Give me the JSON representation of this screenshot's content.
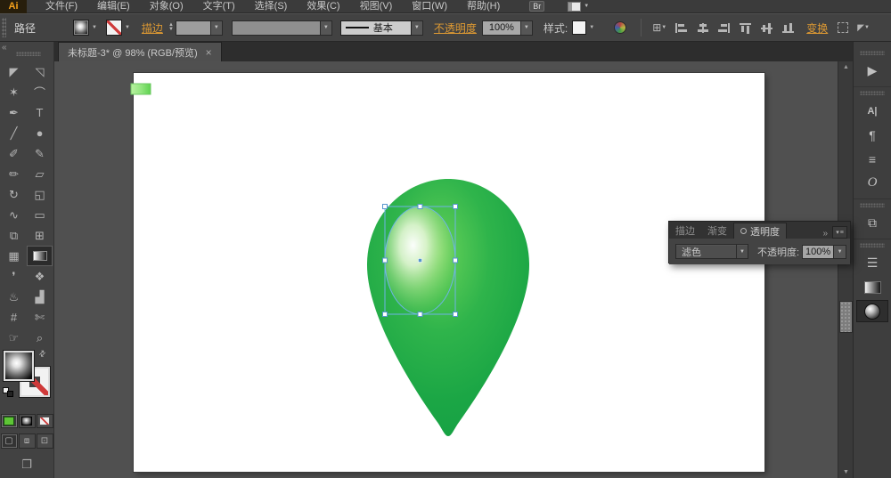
{
  "menubar": {
    "logo": "Ai",
    "items": [
      "文件(F)",
      "编辑(E)",
      "对象(O)",
      "文字(T)",
      "选择(S)",
      "效果(C)",
      "视图(V)",
      "窗口(W)",
      "帮助(H)"
    ],
    "bridge_button": "Br"
  },
  "controlbar": {
    "context_label": "路径",
    "stroke_link": "描边",
    "brush_definition": "基本",
    "opacity_link": "不透明度",
    "opacity_value": "100%",
    "style_label": "样式:",
    "transform_link": "变换"
  },
  "tabbar": {
    "document_title": "未标题-3* @ 98% (RGB/预览)"
  },
  "tools": [
    {
      "name": "selection-tool",
      "active": false
    },
    {
      "name": "direct-selection-tool",
      "active": false
    },
    {
      "name": "magic-wand-tool",
      "active": false
    },
    {
      "name": "lasso-tool",
      "active": false
    },
    {
      "name": "pen-tool",
      "active": false
    },
    {
      "name": "type-tool",
      "active": false
    },
    {
      "name": "line-segment-tool",
      "active": false
    },
    {
      "name": "ellipse-tool",
      "active": false
    },
    {
      "name": "paintbrush-tool",
      "active": false
    },
    {
      "name": "pencil-tool",
      "active": false
    },
    {
      "name": "blob-brush-tool",
      "active": false
    },
    {
      "name": "eraser-tool",
      "active": false
    },
    {
      "name": "rotate-tool",
      "active": false
    },
    {
      "name": "scale-tool",
      "active": false
    },
    {
      "name": "width-tool",
      "active": false
    },
    {
      "name": "free-transform-tool",
      "active": false
    },
    {
      "name": "shape-builder-tool",
      "active": false
    },
    {
      "name": "perspective-grid-tool",
      "active": false
    },
    {
      "name": "mesh-tool",
      "active": false
    },
    {
      "name": "gradient-tool",
      "active": true
    },
    {
      "name": "eyedropper-tool",
      "active": false
    },
    {
      "name": "blend-tool",
      "active": false
    },
    {
      "name": "symbol-sprayer-tool",
      "active": false
    },
    {
      "name": "column-graph-tool",
      "active": false
    },
    {
      "name": "artboard-tool",
      "active": false
    },
    {
      "name": "slice-tool",
      "active": false
    },
    {
      "name": "hand-tool",
      "active": false
    },
    {
      "name": "zoom-tool",
      "active": false
    }
  ],
  "dock_icons": [
    {
      "name": "play-icon",
      "group_start": true
    },
    {
      "name": "character-panel-icon",
      "group_start": true
    },
    {
      "name": "paragraph-panel-icon"
    },
    {
      "name": "paragraph-styles-panel-icon"
    },
    {
      "name": "opentype-panel-icon"
    },
    {
      "name": "appearance-panel-icon",
      "group_start": true
    },
    {
      "name": "stroke-panel-icon",
      "group_start": true
    },
    {
      "name": "gradient-panel-icon"
    },
    {
      "name": "transparency-panel-icon",
      "active": true
    }
  ],
  "transparency_panel": {
    "tabs": [
      "描边",
      "渐变",
      "透明度"
    ],
    "active_tab": "透明度",
    "blend_mode": "滤色",
    "opacity_label": "不透明度:",
    "opacity_value": "100%"
  },
  "artwork": {
    "egg_green_light": "#62cf58",
    "egg_green_mid": "#2fb44b",
    "egg_green_deep": "#16a044",
    "highlight_color": "#ffffff",
    "selection_blue": "#6fb3e6",
    "accent_orange": "#dd9933"
  }
}
